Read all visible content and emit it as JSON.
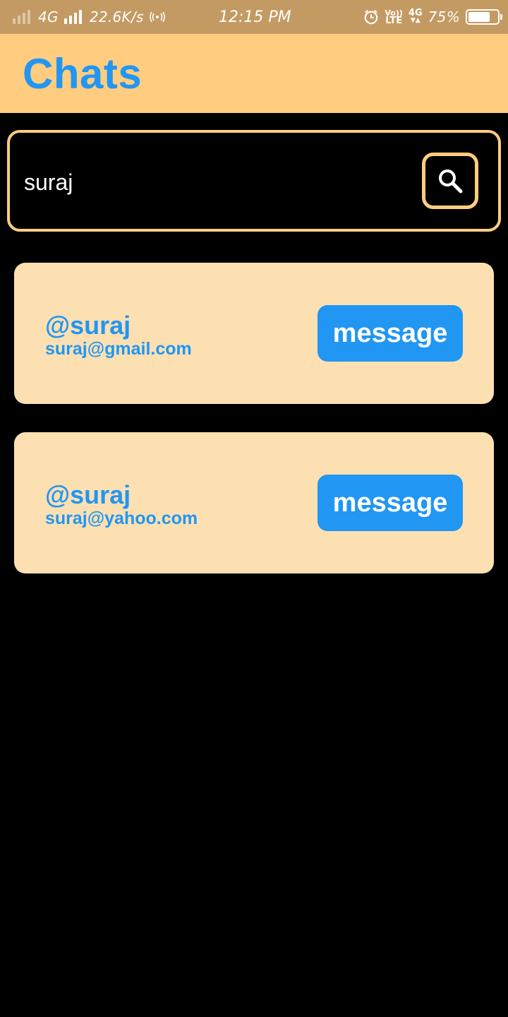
{
  "status_bar": {
    "network": "4G",
    "speed": "22.6K/s",
    "time": "12:15 PM",
    "volte_top": "Vo))",
    "volte_bottom": "LTE",
    "network2": "4G",
    "battery": "75%",
    "battery_level": 0.75
  },
  "header": {
    "title": "Chats"
  },
  "search": {
    "value": "suraj",
    "icon": "search-icon"
  },
  "results": [
    {
      "username": "@suraj",
      "email": "suraj@gmail.com",
      "button_label": "message"
    },
    {
      "username": "@suraj",
      "email": "suraj@yahoo.com",
      "button_label": "message"
    }
  ],
  "colors": {
    "status_bar": "#C49A63",
    "header_bg": "#FFCC80",
    "accent": "#2196F3",
    "card_bg": "#FDE0B2",
    "background": "#000000"
  }
}
